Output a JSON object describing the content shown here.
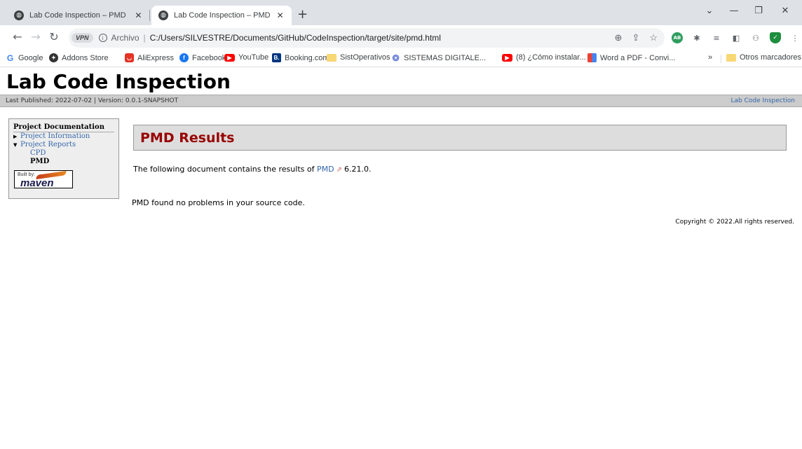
{
  "browser": {
    "tabs": [
      {
        "title": "Lab Code Inspection – PMD Results",
        "active": false
      },
      {
        "title": "Lab Code Inspection – PMD Results",
        "active": true
      }
    ],
    "address": {
      "vpn_label": "VPN",
      "scheme_label": "Archivo",
      "url": "C:/Users/SILVESTRE/Documents/GitHub/CodeInspection/target/site/pmd.html"
    },
    "bookmarks": [
      {
        "label": "Google",
        "icon": "google-icon"
      },
      {
        "label": "Addons Store",
        "icon": "addons-icon"
      },
      {
        "label": "AliExpress",
        "icon": "aliexpress-icon"
      },
      {
        "label": "Facebook",
        "icon": "facebook-icon"
      },
      {
        "label": "YouTube",
        "icon": "youtube-icon"
      },
      {
        "label": "Booking.com",
        "icon": "booking-icon"
      },
      {
        "label": "SistOperativos",
        "icon": "folder-icon"
      },
      {
        "label": "SISTEMAS DIGITALE...",
        "icon": "link-icon"
      },
      {
        "label": "(8) ¿Cómo instalar...",
        "icon": "youtube-icon"
      },
      {
        "label": "Word a PDF - Convi...",
        "icon": "word-pdf-icon"
      },
      {
        "label": "Otros marcadores",
        "icon": "folder-icon"
      }
    ],
    "bookmarks_overflow": "»",
    "colors": {
      "tabstrip": "#dee1e6",
      "omnibox": "#f1f3f4"
    }
  },
  "site": {
    "title": "Lab Code Inspection",
    "published": "Last Published: 2022-07-02",
    "separator": " | ",
    "version": "Version: 0.0.1-SNAPSHOT",
    "project_link": "Lab Code Inspection",
    "nav": {
      "heading": "Project Documentation",
      "items": [
        {
          "label": "Project Information",
          "expanded": false
        },
        {
          "label": "Project Reports",
          "expanded": true
        }
      ],
      "sub_items": [
        {
          "label": "CPD",
          "current": false
        },
        {
          "label": "PMD",
          "current": true
        }
      ],
      "badge_built": "Built by:",
      "badge_maven": "maven"
    },
    "section": {
      "title": "PMD Results",
      "intro_before": "The following document contains the results of ",
      "intro_link": "PMD",
      "intro_after": "6.21.0.",
      "result": "PMD found no problems in your source code."
    },
    "footer": "Copyright © 2022.All rights reserved.",
    "colors": {
      "section_title": "#990000",
      "link": "#3366aa",
      "breadcrumb_bg": "#cccccc"
    }
  }
}
